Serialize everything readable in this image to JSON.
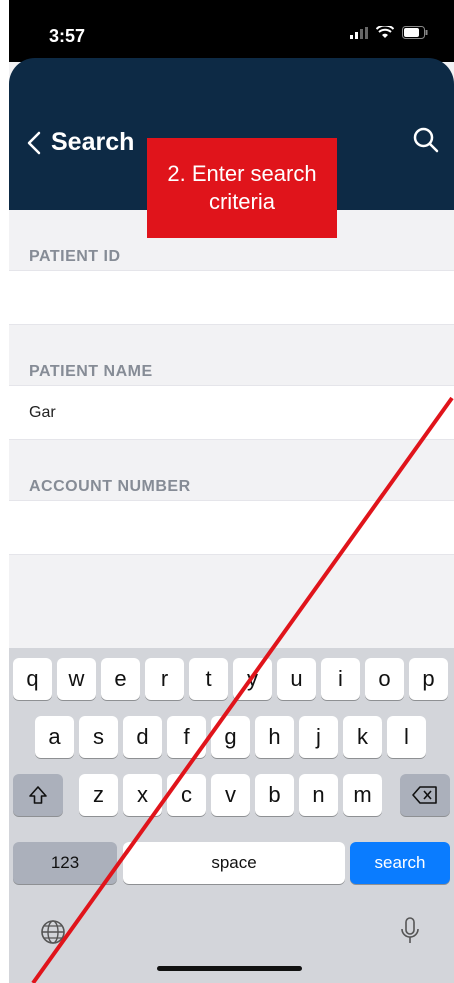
{
  "status_bar": {
    "time": "3:57"
  },
  "navbar": {
    "back_label": "Search",
    "back_icon": "chevron-left-icon",
    "search_icon": "magnifier-icon",
    "bg_color": "#0d2a45"
  },
  "callout": {
    "text": "2. Enter search criteria",
    "color": "#e0141b"
  },
  "form": {
    "patient_id": {
      "label": "PATIENT ID",
      "value": ""
    },
    "patient_name": {
      "label": "PATIENT NAME",
      "value": "Gar"
    },
    "account_number": {
      "label": "ACCOUNT NUMBER",
      "value": ""
    }
  },
  "keyboard": {
    "row1": [
      "q",
      "w",
      "e",
      "r",
      "t",
      "y",
      "u",
      "i",
      "o",
      "p"
    ],
    "row2": [
      "a",
      "s",
      "d",
      "f",
      "g",
      "h",
      "j",
      "k",
      "l"
    ],
    "row3": [
      "z",
      "x",
      "c",
      "v",
      "b",
      "n",
      "m"
    ],
    "numbers_label": "123",
    "space_label": "space",
    "search_label": "search",
    "search_color": "#0a7cff"
  },
  "annotation_line_color": "#e0141b"
}
